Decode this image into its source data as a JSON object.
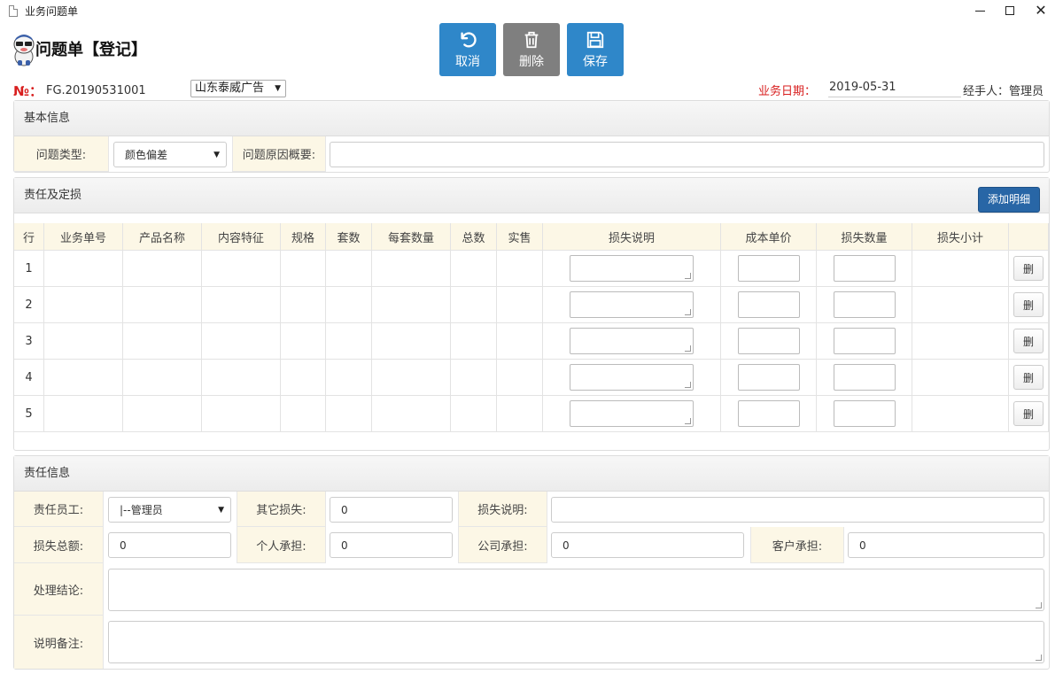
{
  "window": {
    "title": "业务问题单"
  },
  "header": {
    "page_title": "问题单【登记】",
    "buttons": {
      "cancel": "取消",
      "delete": "删除",
      "save": "保存"
    }
  },
  "info": {
    "no_label": "№：",
    "no_value": "FG.20190531001",
    "company": "山东泰威广告",
    "date_label": "业务日期：",
    "date_value": "2019-05-31",
    "handler": "经手人：管理员"
  },
  "basic": {
    "title": "基本信息",
    "type_label": "问题类型:",
    "type_value": "颜色偏差",
    "reason_label": "问题原因概要:",
    "reason_value": ""
  },
  "liability": {
    "title": "责任及定损",
    "add_button": "添加明细",
    "columns": [
      "行",
      "业务单号",
      "产品名称",
      "内容特征",
      "规格",
      "套数",
      "每套数量",
      "总数",
      "实售",
      "损失说明",
      "成本单价",
      "损失数量",
      "损失小计",
      ""
    ],
    "rows": [
      "1",
      "2",
      "3",
      "4",
      "5"
    ],
    "delete_label": "删"
  },
  "resp": {
    "title": "责任信息",
    "employee_label": "责任员工:",
    "employee_value": "|--管理员",
    "other_loss_label": "其它损失:",
    "other_loss_value": "0",
    "loss_desc_label": "损失说明:",
    "loss_desc_value": "",
    "total_loss_label": "损失总额:",
    "total_loss_value": "0",
    "personal_label": "个人承担:",
    "personal_value": "0",
    "company_label": "公司承担:",
    "company_value": "0",
    "customer_label": "客户承担:",
    "customer_value": "0",
    "conclusion_label": "处理结论:",
    "remark_label": "说明备注:"
  }
}
